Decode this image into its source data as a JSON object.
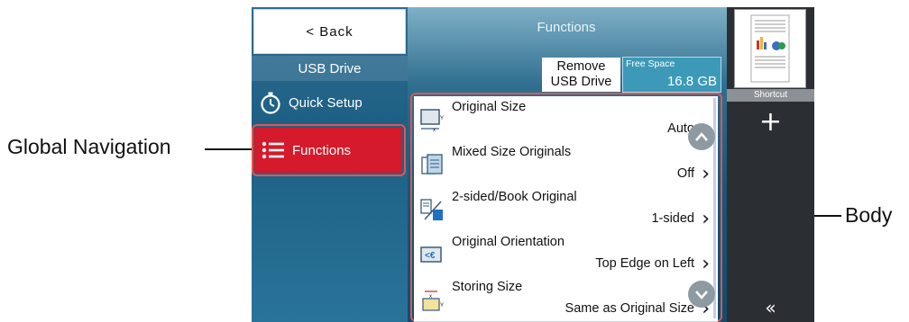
{
  "callouts": {
    "global_nav": "Global Navigation",
    "body": "Body"
  },
  "sidebar": {
    "back_label": "< Back",
    "usb_label": "USB Drive",
    "items": [
      {
        "label": "Quick Setup",
        "icon": "stopwatch-icon"
      },
      {
        "label": "Functions",
        "icon": "list-icon"
      }
    ]
  },
  "main": {
    "title": "Functions",
    "remove_line1": "Remove",
    "remove_line2": "USB Drive",
    "free_space_label": "Free Space",
    "free_space_value": "16.8 GB"
  },
  "functions": [
    {
      "name": "Original Size",
      "value": "Auto"
    },
    {
      "name": "Mixed Size Originals",
      "value": "Off"
    },
    {
      "name": "2-sided/Book Original",
      "value": "1-sided"
    },
    {
      "name": "Original Orientation",
      "value": "Top Edge on Left"
    },
    {
      "name": "Storing Size",
      "value": "Same as Original Size"
    }
  ],
  "right_panel": {
    "shortcut_label": "Shortcut",
    "add_icon": "plus-icon",
    "collapse_icon": "double-chevron-left-icon"
  },
  "colors": {
    "active_nav": "#d51a2b",
    "callout_outline": "#e2564d",
    "panel_dark": "#2b2f33"
  }
}
